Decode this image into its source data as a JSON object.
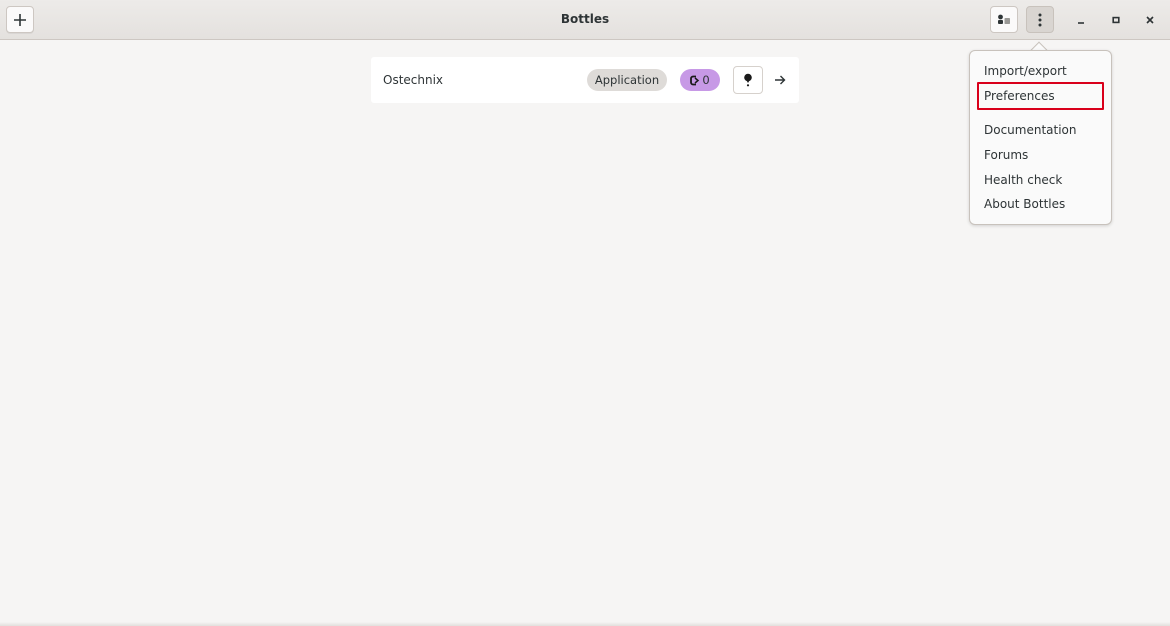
{
  "window": {
    "title": "Bottles"
  },
  "header": {
    "new_icon": "plus-icon",
    "library_icon": "library-icon",
    "menu_icon": "vertical-dots-icon",
    "minimize_icon": "minimize-icon",
    "maximize_icon": "maximize-icon",
    "close_icon": "close-icon"
  },
  "bottles": [
    {
      "name": "Ostechnix",
      "environment": "Application",
      "versioning_count": "0",
      "run_icon": "run-icon",
      "open_icon": "arrow-right-icon"
    }
  ],
  "main_menu": {
    "items": [
      {
        "label": "Import/export"
      },
      {
        "label": "Preferences",
        "highlighted": true
      },
      {
        "label": "Documentation"
      },
      {
        "label": "Forums"
      },
      {
        "label": "Health check"
      },
      {
        "label": "About Bottles"
      }
    ]
  },
  "colors": {
    "accent_highlight": "#d9001b",
    "version_badge": "#c799e6",
    "env_badge": "#dedbd8"
  }
}
